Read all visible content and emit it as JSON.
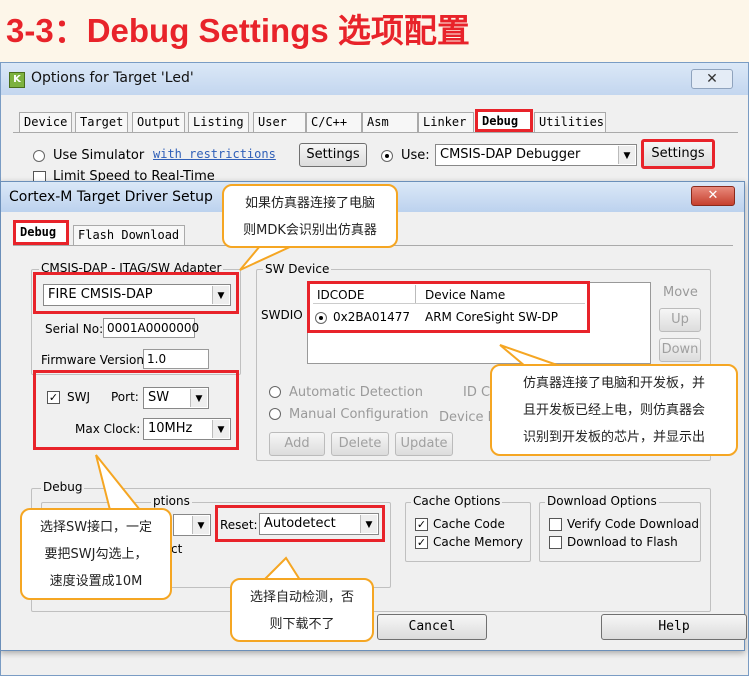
{
  "page_title": "3-3：Debug Settings 选项配置",
  "outer_dialog": {
    "title": "Options for Target 'Led'",
    "close": "✕",
    "tabs": [
      "Device",
      "Target",
      "Output",
      "Listing",
      "User",
      "C/C++",
      "Asm",
      "Linker",
      "Debug",
      "Utilities"
    ],
    "active_tab": "Debug",
    "use_simulator": "Use Simulator",
    "with_restrictions": "with restrictions",
    "settings_left": "Settings",
    "use_label": "Use:",
    "debugger": "CMSIS-DAP Debugger",
    "settings_right": "Settings",
    "limit_speed": "Limit Speed to Real-Time"
  },
  "inner_dialog": {
    "title": "Cortex-M Target Driver Setup",
    "close": "✕",
    "tabs": [
      "Debug",
      "Flash Download"
    ],
    "adapter_group": "CMSIS-DAP - JTAG/SW Adapter",
    "adapter": "FIRE CMSIS-DAP",
    "serial_label": "Serial No:",
    "serial": "0001A0000000",
    "firmware_label": "Firmware Version:",
    "firmware": "1.0",
    "swj_label": "SWJ",
    "port_label": "Port:",
    "port": "SW",
    "max_clock_label": "Max Clock:",
    "max_clock": "10MHz",
    "sw_device_group": "SW Device",
    "swdio": "SWDIO",
    "col_idcode": "IDCODE",
    "col_device": "Device Name",
    "idcode": "0x2BA01477",
    "device_name": "ARM CoreSight SW-DP",
    "move": "Move",
    "up": "Up",
    "down": "Down",
    "auto_detect": "Automatic Detection",
    "manual_config": "Manual Configuration",
    "id_c": "ID C",
    "device_n": "Device N",
    "add": "Add",
    "delete": "Delete",
    "update": "Update",
    "debug_group": "Debug",
    "connect_options": "Connect & Reset Options",
    "options_frag": "ptions",
    "reset_label": "Reset:",
    "reset": "Autodetect",
    "ct_frag": "ct",
    "cache_group": "Cache Options",
    "cache_code": "Cache Code",
    "cache_memory": "Cache Memory",
    "download_group": "Download Options",
    "verify_code": "Verify Code Download",
    "download_flash": "Download to Flash",
    "cancel": "Cancel",
    "help": "Help"
  },
  "callouts": {
    "c1_line1": "如果仿真器连接了电脑",
    "c1_line2": "则MDK会识别出仿真器",
    "c2_line1": "仿真器连接了电脑和开发板，并",
    "c2_line2": "且开发板已经上电，则仿真器会",
    "c2_line3": "识别到开发板的芯片，并显示出",
    "c3_line1": "选择SW接口，一定",
    "c3_line2": "要把SWJ勾选上，",
    "c3_line3": "速度设置成10M",
    "c4_line1": "选择自动检测，否",
    "c4_line2": "则下载不了"
  },
  "colors": {
    "highlight": "#e8232a",
    "callout_border": "#f5a623",
    "title_red": "#e8232a"
  }
}
